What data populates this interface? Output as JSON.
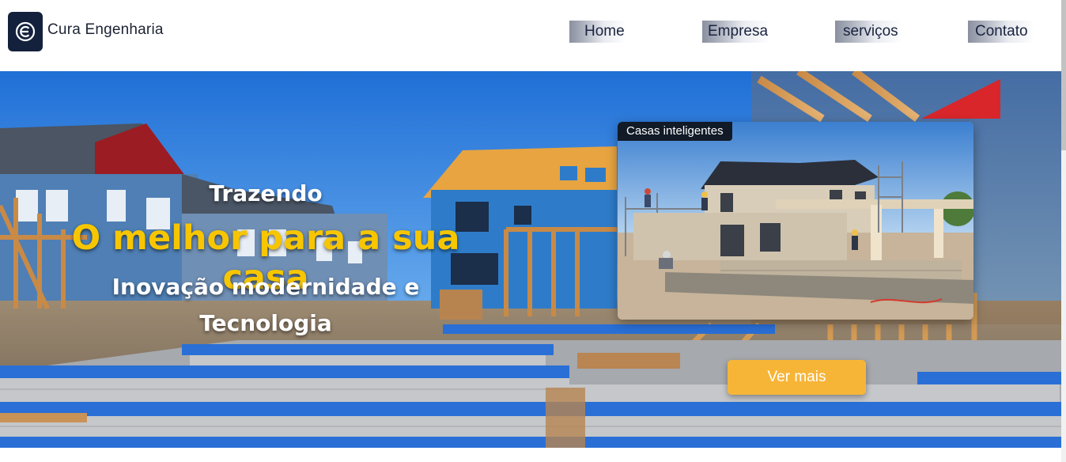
{
  "header": {
    "brand": "Cura Engenharia",
    "logo_icon": "letter-c-circle-icon",
    "nav": [
      "Home",
      "Empresa",
      "serviços",
      "Contato"
    ]
  },
  "hero": {
    "line1": "Trazendo",
    "headline": "O melhor para a sua casa",
    "sub1": "Inovação modernidade e",
    "sub2": "Tecnologia",
    "card_caption": "Casas inteligentes",
    "cta": "Ver mais"
  },
  "colors": {
    "logo_bg": "#14213d",
    "headline": "#f7c600",
    "cta": "#f7b538"
  }
}
